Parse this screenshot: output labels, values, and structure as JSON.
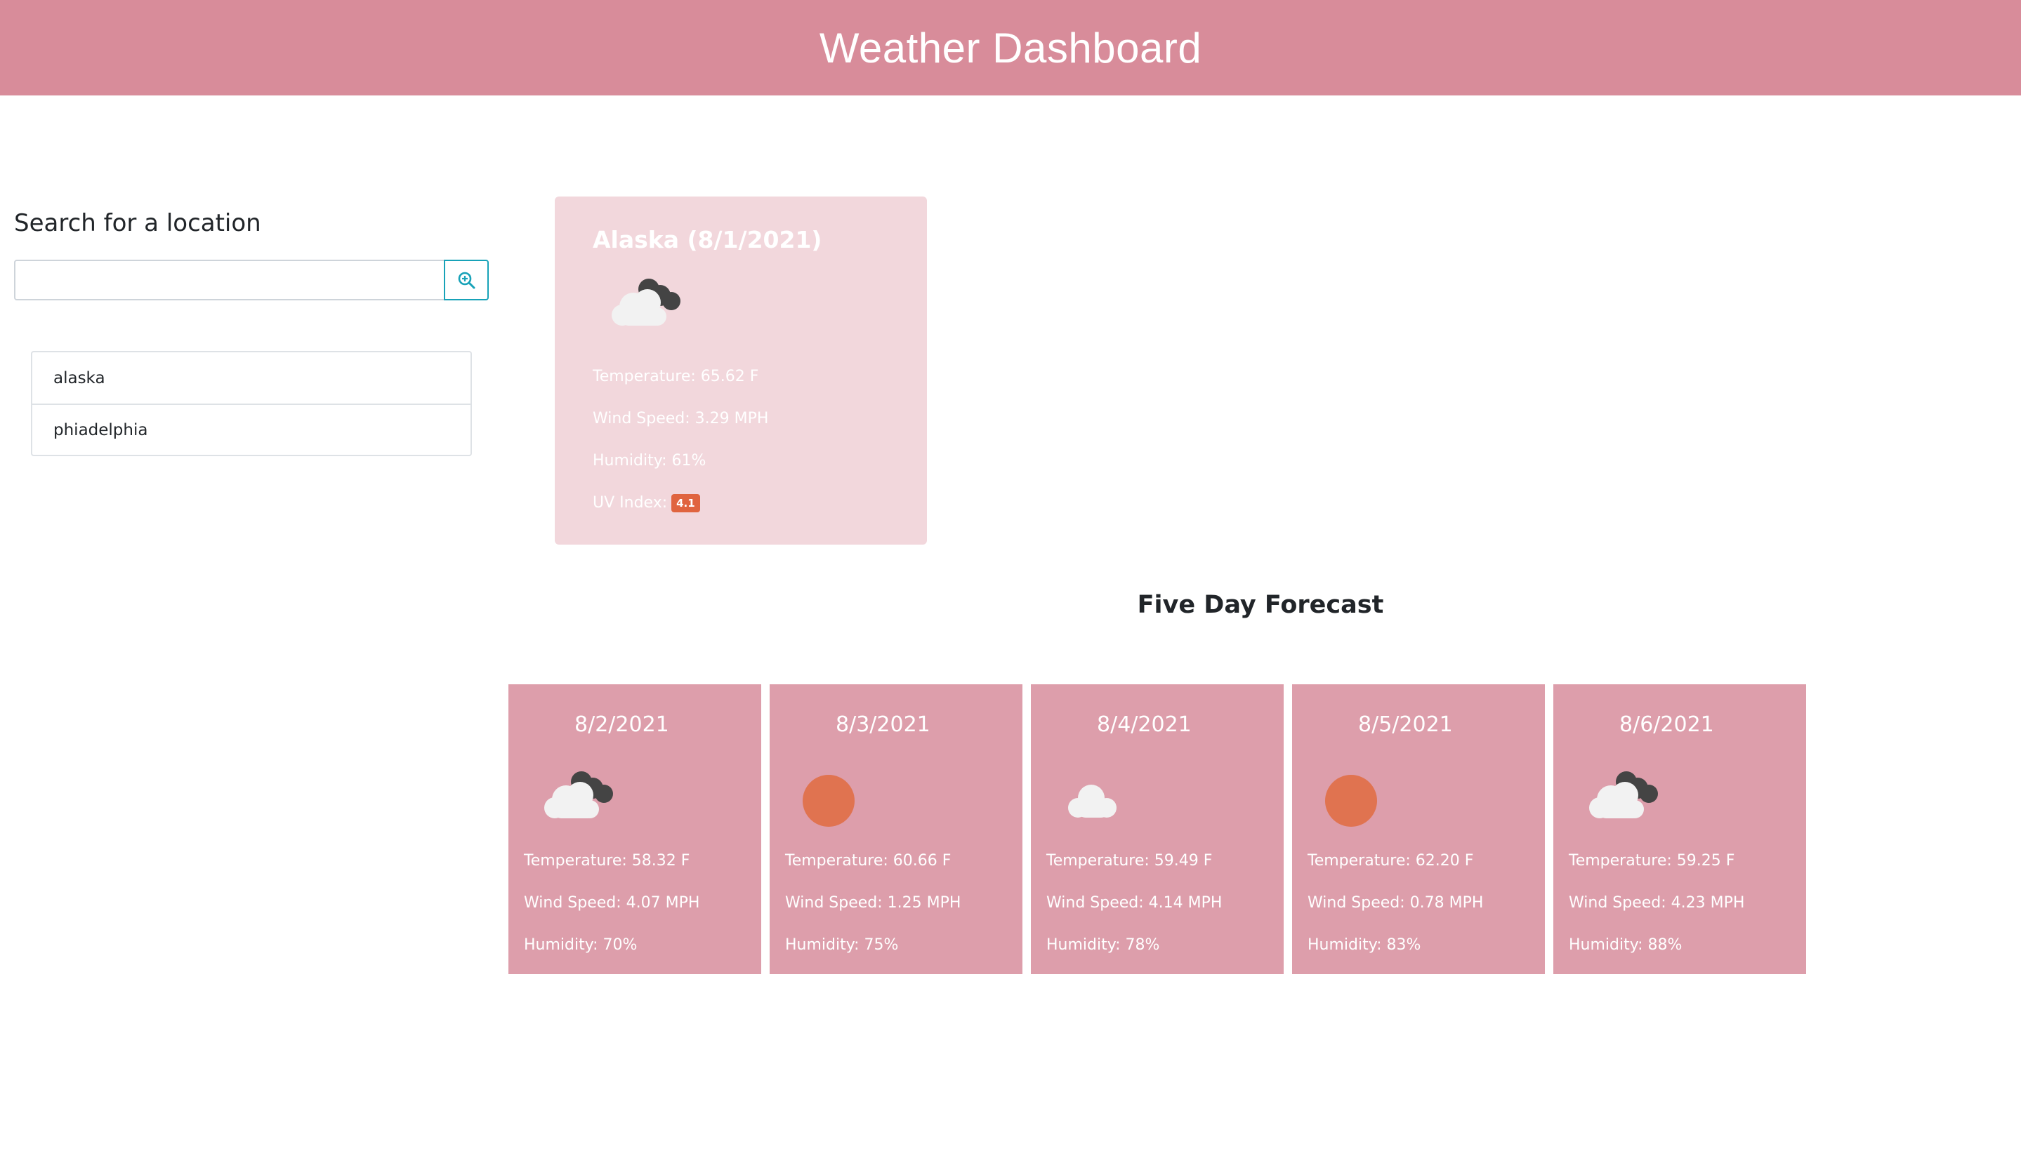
{
  "header": {
    "title": "Weather Dashboard"
  },
  "search": {
    "title": "Search for a location",
    "input_value": "",
    "placeholder": "",
    "button_icon": "search-zoom-icon"
  },
  "history": [
    "alaska",
    "phiadelphia"
  ],
  "current": {
    "title": "Alaska (8/1/2021)",
    "icon": "cloudy-icon",
    "temperature": "Temperature: 65.62 F",
    "wind": "Wind Speed: 3.29 MPH",
    "humidity": "Humidity: 61%",
    "uv_label": "UV Index:",
    "uv_value": "4.1"
  },
  "forecast_title": "Five Day Forecast",
  "forecast": [
    {
      "date": "8/2/2021",
      "icon": "cloudy-icon",
      "temperature": "Temperature: 58.32 F",
      "wind": "Wind Speed: 4.07 MPH",
      "humidity": "Humidity: 70%"
    },
    {
      "date": "8/3/2021",
      "icon": "sun-icon",
      "temperature": "Temperature: 60.66 F",
      "wind": "Wind Speed: 1.25 MPH",
      "humidity": "Humidity: 75%"
    },
    {
      "date": "8/4/2021",
      "icon": "cloud-icon",
      "temperature": "Temperature: 59.49 F",
      "wind": "Wind Speed: 4.14 MPH",
      "humidity": "Humidity: 78%"
    },
    {
      "date": "8/5/2021",
      "icon": "sun-icon",
      "temperature": "Temperature: 62.20 F",
      "wind": "Wind Speed: 0.78 MPH",
      "humidity": "Humidity: 83%"
    },
    {
      "date": "8/6/2021",
      "icon": "cloudy-icon",
      "temperature": "Temperature: 59.25 F",
      "wind": "Wind Speed: 4.23 MPH",
      "humidity": "Humidity: 88%"
    }
  ],
  "colors": {
    "header": "#d88c9a",
    "current_card": "#f2d7dc",
    "forecast_card": "#dd9eab",
    "uv_badge": "#e0643f",
    "sun": "#e07350"
  }
}
